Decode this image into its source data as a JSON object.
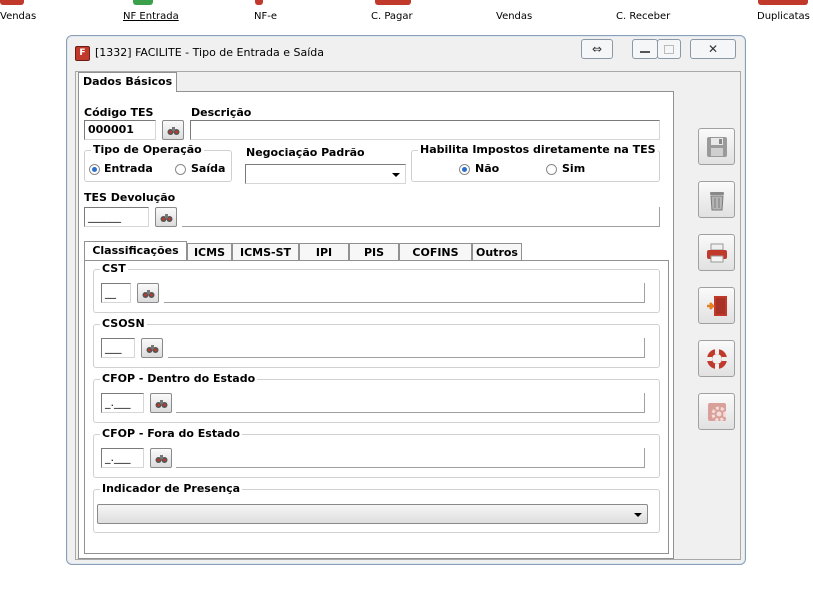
{
  "toolbar": {
    "items": [
      "Vendas",
      "NF Entrada",
      "NF-e",
      "C. Pagar",
      "Vendas",
      "C. Receber",
      "Duplicatas"
    ]
  },
  "window": {
    "title": "[1332] FACILITE - Tipo de Entrada e Saída",
    "app_icon_letter": "F"
  },
  "tabs": {
    "main": "Dados Básicos"
  },
  "form": {
    "codigo_label": "Código TES",
    "codigo_value": "000001",
    "descricao_label": "Descrição",
    "descricao_value": "",
    "tipo_operacao_label": "Tipo de Operação",
    "tipo_entrada": "Entrada",
    "tipo_saida": "Saída",
    "negociacao_label": "Negociação Padrão",
    "negociacao_value": "",
    "habilita_label": "Habilita Impostos diretamente na TES",
    "habilita_nao": "Não",
    "habilita_sim": "Sim",
    "tes_devolucao_label": "TES Devolução",
    "tes_devolucao_mask": "______"
  },
  "inner_tabs": [
    "Classificações",
    "ICMS",
    "ICMS-ST",
    "IPI",
    "PIS",
    "COFINS",
    "Outros"
  ],
  "classificacoes": {
    "cst_label": "CST",
    "cst_mask": "__",
    "csosn_label": "CSOSN",
    "csosn_mask": "___",
    "cfop_dentro_label": "CFOP - Dentro do Estado",
    "cfop_dentro_mask": "_.___",
    "cfop_fora_label": "CFOP - Fora do Estado",
    "cfop_fora_mask": "_.___",
    "indicador_label": "Indicador de Presença",
    "indicador_value": ""
  },
  "side_buttons": [
    "save-icon",
    "trash-icon",
    "printer-icon",
    "exit-door-icon",
    "lifebuoy-help-icon",
    "settings-gear-icon"
  ],
  "colors": {
    "accent": "#c0392b",
    "radio_selected": "#2a6fc9"
  }
}
